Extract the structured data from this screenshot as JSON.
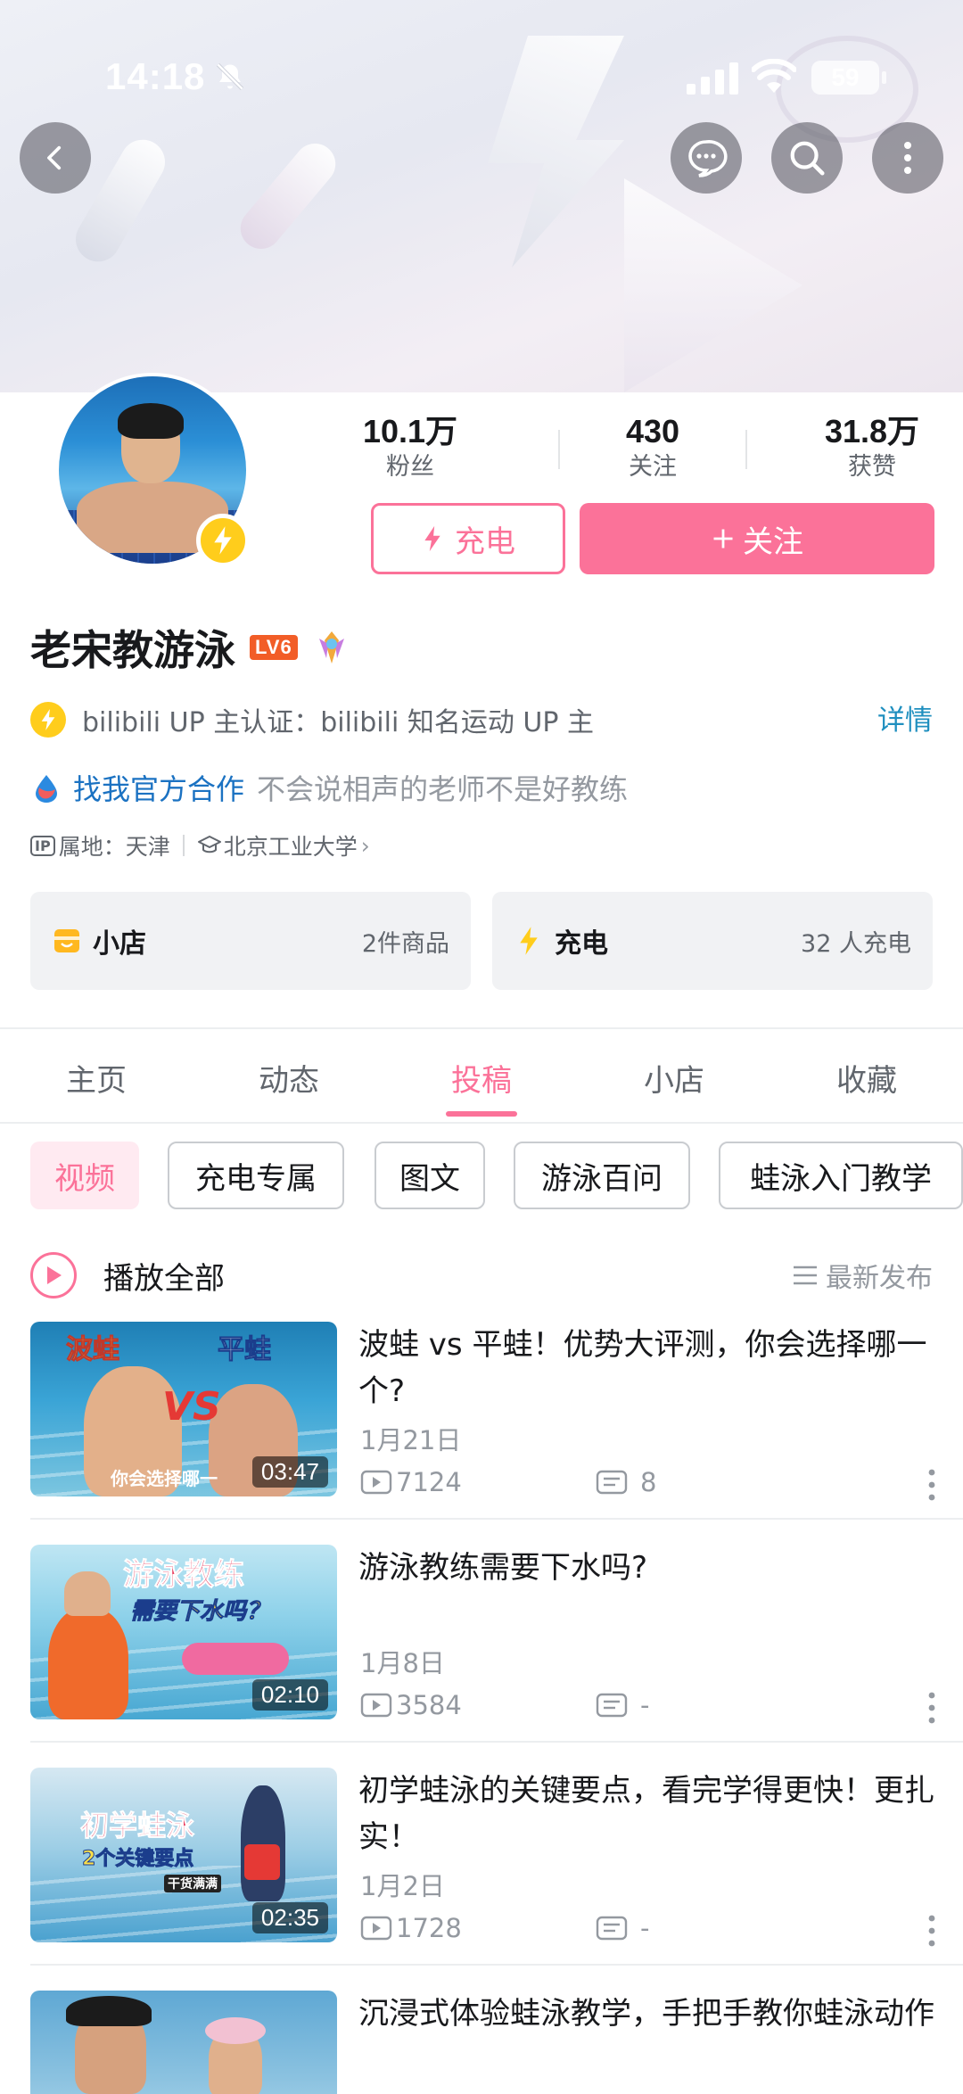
{
  "status_bar": {
    "time": "14:18",
    "battery": "59"
  },
  "stats": [
    {
      "value": "10.1万",
      "label": "粉丝"
    },
    {
      "value": "430",
      "label": "关注"
    },
    {
      "value": "31.8万",
      "label": "获赞"
    }
  ],
  "actions": {
    "charge_label": "充电",
    "follow_label": "关注"
  },
  "profile": {
    "name": "老宋教游泳",
    "level": "LV6",
    "verify_text": "bilibili UP 主认证：bilibili 知名运动 UP 主",
    "verify_detail": "详情",
    "bio_link": "找我官方合作",
    "bio": "不会说相声的老师不是好教练",
    "ip_tag": "IP",
    "ip_location": "属地：天津",
    "school": "北京工业大学"
  },
  "cards": {
    "shop": {
      "title": "小店",
      "count": "2件商品"
    },
    "charge": {
      "title": "充电",
      "count": "32 人充电"
    }
  },
  "tabs": [
    "主页",
    "动态",
    "投稿",
    "小店",
    "收藏"
  ],
  "active_tab": "投稿",
  "filters": [
    "视频",
    "充电专属",
    "图文",
    "游泳百问",
    "蛙泳入门教学"
  ],
  "play_all": {
    "label": "播放全部",
    "sort": "最新发布"
  },
  "videos": [
    {
      "title": "波蛙 vs 平蛙！优势大评测，你会选择哪一个?",
      "date": "1月21日",
      "plays": "7124",
      "danmaku": "8",
      "duration": "03:47",
      "thumb_text": [
        "波蛙",
        "平蛙",
        "VS",
        "你会选择哪一"
      ]
    },
    {
      "title": "游泳教练需要下水吗?",
      "date": "1月8日",
      "plays": "3584",
      "danmaku": "-",
      "duration": "02:10",
      "thumb_text": [
        "游泳教练",
        "需要下水吗？"
      ]
    },
    {
      "title": "初学蛙泳的关键要点，看完学得更快！更扎实！",
      "date": "1月2日",
      "plays": "1728",
      "danmaku": "-",
      "duration": "02:35",
      "thumb_text": [
        "初学蛙泳",
        "2个关键要点",
        "干货满满"
      ]
    },
    {
      "title": "沉浸式体验蛙泳教学，手把手教你蛙泳动作",
      "date": "",
      "plays": "",
      "danmaku": "",
      "duration": "",
      "thumb_text": []
    }
  ],
  "colors": {
    "accent": "#fb7299",
    "gold": "#ffcd1c",
    "link": "#1b72c2",
    "muted": "#9499a0"
  }
}
